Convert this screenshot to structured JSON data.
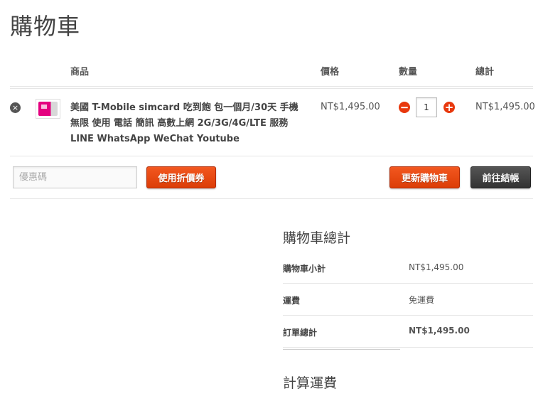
{
  "page": {
    "title": "購物車"
  },
  "table": {
    "headers": {
      "product": "商品",
      "price": "價格",
      "quantity": "數量",
      "total": "總計"
    }
  },
  "cart_items": [
    {
      "remove_icon": "×",
      "name": "美國 T-Mobile simcard 吃到飽 包一個月/30天 手機 無限 使用 電話 簡訊 高數上網 2G/3G/4G/LTE 服務 LINE WhatsApp WeChat Youtube",
      "price": "NT$1,495.00",
      "quantity": "1",
      "subtotal": "NT$1,495.00"
    }
  ],
  "icons": {
    "remove": "remove-circle-icon",
    "minus": "minus-circle-icon",
    "plus": "plus-circle-icon"
  },
  "actions": {
    "coupon_placeholder": "優惠碼",
    "apply_coupon": "使用折價券",
    "update_cart": "更新購物車",
    "checkout": "前往結帳"
  },
  "cart_totals": {
    "title": "購物車總計",
    "rows": [
      {
        "label": "購物車小計",
        "value": "NT$1,495.00"
      },
      {
        "label": "運費",
        "value": "免運費"
      },
      {
        "label": "訂單總計",
        "value": "NT$1,495.00"
      }
    ]
  },
  "shipping_calc": {
    "title": "計算運費"
  },
  "colors": {
    "accent": "#e8380d",
    "dark_button": "#3a3a3a",
    "text": "#444444"
  }
}
